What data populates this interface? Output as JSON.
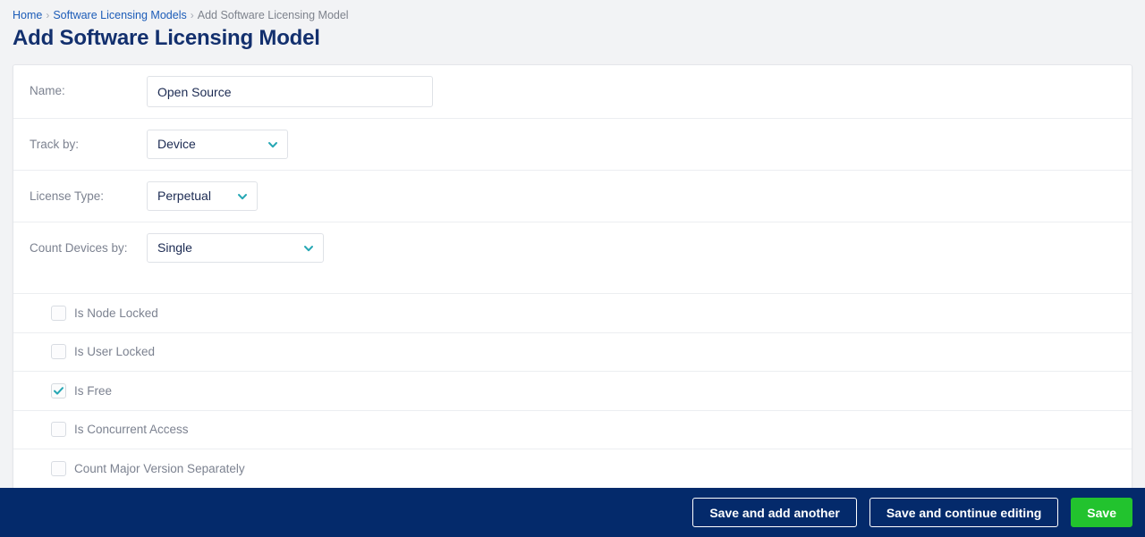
{
  "breadcrumb": {
    "items": [
      {
        "label": "Home",
        "type": "link"
      },
      {
        "label": "Software Licensing Models",
        "type": "link"
      },
      {
        "label": "Add Software Licensing Model",
        "type": "current"
      }
    ],
    "separator": "›"
  },
  "page": {
    "title": "Add Software Licensing Model"
  },
  "form": {
    "fields": [
      {
        "label": "Name:",
        "control": "text",
        "value": "Open Source",
        "placeholder": ""
      },
      {
        "label": "Track by:",
        "control": "select",
        "value": "Device"
      },
      {
        "label": "License Type:",
        "control": "select",
        "value": "Perpetual"
      },
      {
        "label": "Count Devices by:",
        "control": "select",
        "value": "Single"
      }
    ],
    "checkboxes": [
      {
        "label": "Is Node Locked",
        "checked": false
      },
      {
        "label": "Is User Locked",
        "checked": false
      },
      {
        "label": "Is Free",
        "checked": true
      },
      {
        "label": "Is Concurrent Access",
        "checked": false
      },
      {
        "label": "Count Major Version Separately",
        "checked": false
      }
    ]
  },
  "footer": {
    "buttons": [
      {
        "label": "Save and add another",
        "style": "outline"
      },
      {
        "label": "Save and continue editing",
        "style": "outline"
      },
      {
        "label": "Save",
        "style": "primary"
      }
    ]
  },
  "icons": {
    "chevron_down": "chevron-down-icon",
    "check": "check-icon"
  },
  "colors": {
    "page_background": "#f2f3f5",
    "title": "#13306e",
    "link": "#1c5cb8",
    "muted_text": "#7c8290",
    "input_text": "#1b2a52",
    "accent_teal": "#26a7b4",
    "footer_navy": "#042a6b",
    "save_green": "#22c32e",
    "border": "#dfe2e7"
  }
}
